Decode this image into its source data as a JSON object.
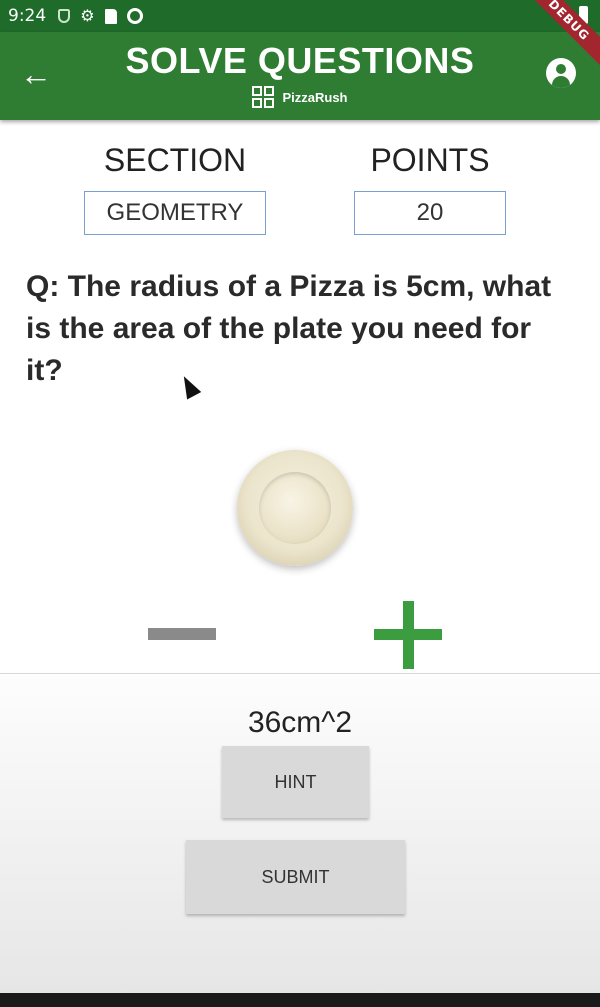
{
  "status_bar": {
    "time": "9:24",
    "left_icons": [
      "shield-icon",
      "gear-icon",
      "sd-card-icon",
      "at-icon"
    ],
    "right_icons": [
      "wifi-icon",
      "battery-icon"
    ],
    "debug_label": "DEBUG"
  },
  "app_bar": {
    "title": "SOLVE QUESTIONS",
    "subtitle": "PizzaRush",
    "color": "#2e7d32"
  },
  "section": {
    "label": "SECTION",
    "value": "GEOMETRY"
  },
  "points": {
    "label": "POINTS",
    "value": "20"
  },
  "question": "Q: The radius of a Pizza is 5cm, what is the area of the plate you need for it?",
  "answer": "36cm^2",
  "buttons": {
    "hint": "HINT",
    "submit": "SUBMIT"
  },
  "colors": {
    "plus": "#3c9c40",
    "minus": "#8a8a8a",
    "field_border": "#7a9fd4"
  }
}
